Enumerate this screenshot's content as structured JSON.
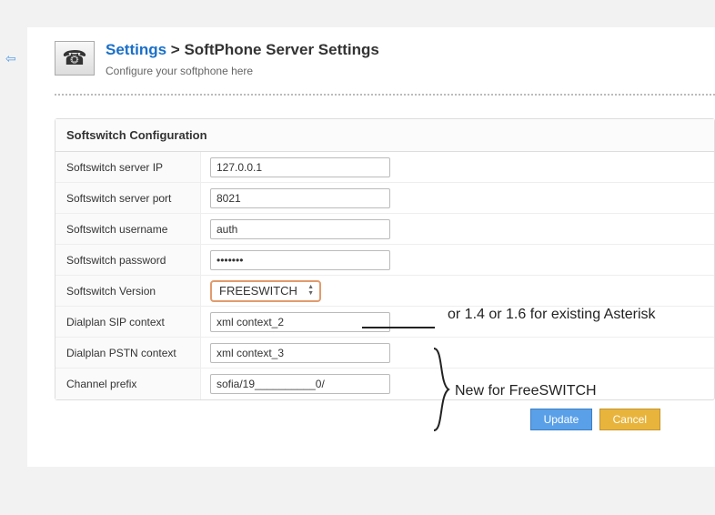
{
  "header": {
    "breadcrumb_link": "Settings",
    "breadcrumb_sep": " > ",
    "title": "SoftPhone Server Settings",
    "subtitle": "Configure your softphone here",
    "icon_glyph": "☎"
  },
  "panel": {
    "title": "Softswitch Configuration",
    "rows": {
      "server_ip": {
        "label": "Softswitch server IP",
        "value": "127.0.0.1"
      },
      "server_port": {
        "label": "Softswitch server port",
        "value": "8021"
      },
      "username": {
        "label": "Softswitch username",
        "value": "auth"
      },
      "password": {
        "label": "Softswitch password",
        "value": "•••••••"
      },
      "version": {
        "label": "Softswitch Version",
        "value": "FREESWITCH"
      },
      "sip_ctx": {
        "label": "Dialplan SIP context",
        "value": "xml context_2"
      },
      "pstn_ctx": {
        "label": "Dialplan PSTN context",
        "value": "xml context_3"
      },
      "chan_prefix": {
        "label": "Channel prefix",
        "value": "sofia/19__________0/"
      }
    }
  },
  "buttons": {
    "update": "Update",
    "cancel": "Cancel"
  },
  "annotations": {
    "version_note": "or 1.4 or 1.6 for existing Asterisk",
    "new_fields": "New for FreeSWITCH"
  }
}
